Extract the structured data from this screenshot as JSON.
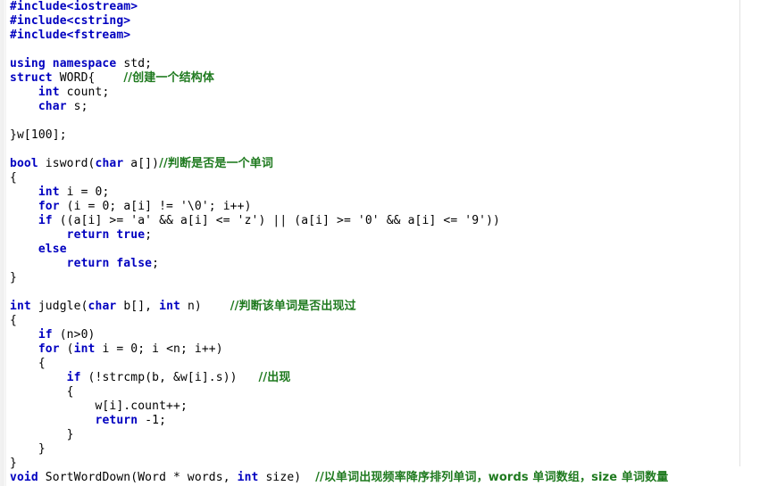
{
  "editor": {
    "language": "C++",
    "background_color": "#ffffff",
    "keyword_color": "#0000C0",
    "comment_color": "#1F7A1F",
    "text_color": "#000000",
    "gutter_color": "#f0f0f0",
    "margin_guide_color": "#e2e2e2",
    "font_size_px": 13,
    "line_height_px": 16,
    "first_visible_line": 1,
    "total_visible_lines": 35
  },
  "code_lines": [
    {
      "n": 1,
      "tokens": [
        {
          "t": "pp",
          "s": "#include<iostream>"
        }
      ]
    },
    {
      "n": 2,
      "tokens": [
        {
          "t": "pp",
          "s": "#include<cstring>"
        }
      ]
    },
    {
      "n": 3,
      "tokens": [
        {
          "t": "pp",
          "s": "#include<fstream>"
        }
      ]
    },
    {
      "n": 4,
      "tokens": []
    },
    {
      "n": 5,
      "tokens": [
        {
          "t": "kw",
          "s": "using namespace"
        },
        {
          "t": "pl",
          "s": " std;"
        }
      ]
    },
    {
      "n": 6,
      "tokens": [
        {
          "t": "kw",
          "s": "struct"
        },
        {
          "t": "pl",
          "s": " WORD{    "
        },
        {
          "t": "cm",
          "s": "//创建一个结构体"
        }
      ]
    },
    {
      "n": 7,
      "tokens": [
        {
          "t": "pl",
          "s": "    "
        },
        {
          "t": "kw",
          "s": "int"
        },
        {
          "t": "pl",
          "s": " count;"
        }
      ]
    },
    {
      "n": 8,
      "tokens": [
        {
          "t": "pl",
          "s": "    "
        },
        {
          "t": "kw",
          "s": "char"
        },
        {
          "t": "pl",
          "s": " s;"
        }
      ]
    },
    {
      "n": 9,
      "tokens": []
    },
    {
      "n": 10,
      "tokens": [
        {
          "t": "pl",
          "s": "}w[100];"
        }
      ]
    },
    {
      "n": 11,
      "tokens": []
    },
    {
      "n": 12,
      "tokens": [
        {
          "t": "kw",
          "s": "bool"
        },
        {
          "t": "pl",
          "s": " isword("
        },
        {
          "t": "kw",
          "s": "char"
        },
        {
          "t": "pl",
          "s": " a[])"
        },
        {
          "t": "cm",
          "s": "//判断是否是一个单词"
        }
      ]
    },
    {
      "n": 13,
      "tokens": [
        {
          "t": "pl",
          "s": "{"
        }
      ]
    },
    {
      "n": 14,
      "tokens": [
        {
          "t": "pl",
          "s": "    "
        },
        {
          "t": "kw",
          "s": "int"
        },
        {
          "t": "pl",
          "s": " i = 0;"
        }
      ]
    },
    {
      "n": 15,
      "tokens": [
        {
          "t": "pl",
          "s": "    "
        },
        {
          "t": "kw",
          "s": "for"
        },
        {
          "t": "pl",
          "s": " (i = 0; a[i] != '\\0'; i++)"
        }
      ]
    },
    {
      "n": 16,
      "tokens": [
        {
          "t": "pl",
          "s": "    "
        },
        {
          "t": "kw",
          "s": "if"
        },
        {
          "t": "pl",
          "s": " ((a[i] >= 'a' && a[i] <= 'z') || (a[i] >= '0' && a[i] <= '9'))"
        }
      ]
    },
    {
      "n": 17,
      "tokens": [
        {
          "t": "pl",
          "s": "        "
        },
        {
          "t": "kw",
          "s": "return true"
        },
        {
          "t": "pl",
          "s": ";"
        }
      ]
    },
    {
      "n": 18,
      "tokens": [
        {
          "t": "pl",
          "s": "    "
        },
        {
          "t": "kw",
          "s": "else"
        }
      ]
    },
    {
      "n": 19,
      "tokens": [
        {
          "t": "pl",
          "s": "        "
        },
        {
          "t": "kw",
          "s": "return false"
        },
        {
          "t": "pl",
          "s": ";"
        }
      ]
    },
    {
      "n": 20,
      "tokens": [
        {
          "t": "pl",
          "s": "}"
        }
      ]
    },
    {
      "n": 21,
      "tokens": []
    },
    {
      "n": 22,
      "tokens": [
        {
          "t": "kw",
          "s": "int"
        },
        {
          "t": "pl",
          "s": " judgle("
        },
        {
          "t": "kw",
          "s": "char"
        },
        {
          "t": "pl",
          "s": " b[], "
        },
        {
          "t": "kw",
          "s": "int"
        },
        {
          "t": "pl",
          "s": " n)    "
        },
        {
          "t": "cm",
          "s": "//判断该单词是否出现过"
        }
      ]
    },
    {
      "n": 23,
      "tokens": [
        {
          "t": "pl",
          "s": "{"
        }
      ]
    },
    {
      "n": 24,
      "tokens": [
        {
          "t": "pl",
          "s": "    "
        },
        {
          "t": "kw",
          "s": "if"
        },
        {
          "t": "pl",
          "s": " (n>0)"
        }
      ]
    },
    {
      "n": 25,
      "tokens": [
        {
          "t": "pl",
          "s": "    "
        },
        {
          "t": "kw",
          "s": "for"
        },
        {
          "t": "pl",
          "s": " ("
        },
        {
          "t": "kw",
          "s": "int"
        },
        {
          "t": "pl",
          "s": " i = 0; i <n; i++)"
        }
      ]
    },
    {
      "n": 26,
      "tokens": [
        {
          "t": "pl",
          "s": "    {"
        }
      ]
    },
    {
      "n": 27,
      "tokens": [
        {
          "t": "pl",
          "s": "        "
        },
        {
          "t": "kw",
          "s": "if"
        },
        {
          "t": "pl",
          "s": " (!strcmp(b, &w[i].s))   "
        },
        {
          "t": "cm",
          "s": "//出现"
        }
      ]
    },
    {
      "n": 28,
      "tokens": [
        {
          "t": "pl",
          "s": "        {"
        }
      ]
    },
    {
      "n": 29,
      "tokens": [
        {
          "t": "pl",
          "s": "            w[i].count++;"
        }
      ]
    },
    {
      "n": 30,
      "tokens": [
        {
          "t": "pl",
          "s": "            "
        },
        {
          "t": "kw",
          "s": "return"
        },
        {
          "t": "pl",
          "s": " -1;"
        }
      ]
    },
    {
      "n": 31,
      "tokens": [
        {
          "t": "pl",
          "s": "        }"
        }
      ]
    },
    {
      "n": 32,
      "tokens": [
        {
          "t": "pl",
          "s": "    }"
        }
      ]
    },
    {
      "n": 33,
      "tokens": [
        {
          "t": "pl",
          "s": "}"
        }
      ]
    },
    {
      "n": 34,
      "tokens": [
        {
          "t": "kw",
          "s": "void"
        },
        {
          "t": "pl",
          "s": " SortWordDown(Word * words, "
        },
        {
          "t": "kw",
          "s": "int"
        },
        {
          "t": "pl",
          "s": " size)  "
        },
        {
          "t": "cm",
          "s": "//以单词出现频率降序排列单词，words 单词数组，size 单词数量"
        }
      ]
    }
  ],
  "plain_text": "#include<iostream>\n#include<cstring>\n#include<fstream>\n\nusing namespace std;\nstruct WORD{    //创建一个结构体\n    int count;\n    char s;\n\n}w[100];\n\nbool isword(char a[])//判断是否是一个单词\n{\n    int i = 0;\n    for (i = 0; a[i] != '\\0'; i++)\n    if ((a[i] >= 'a' && a[i] <= 'z') || (a[i] >= '0' && a[i] <= '9'))\n        return true;\n    else\n        return false;\n}\n\nint judgle(char b[], int n)    //判断该单词是否出现过\n{\n    if (n>0)\n    for (int i = 0; i <n; i++)\n    {\n        if (!strcmp(b, &w[i].s))   //出现\n        {\n            w[i].count++;\n            return -1;\n        }\n    }\n}\nvoid SortWordDown(Word * words, int size)  //以单词出现频率降序排列单词，words 单词数组，size 单词数量"
}
